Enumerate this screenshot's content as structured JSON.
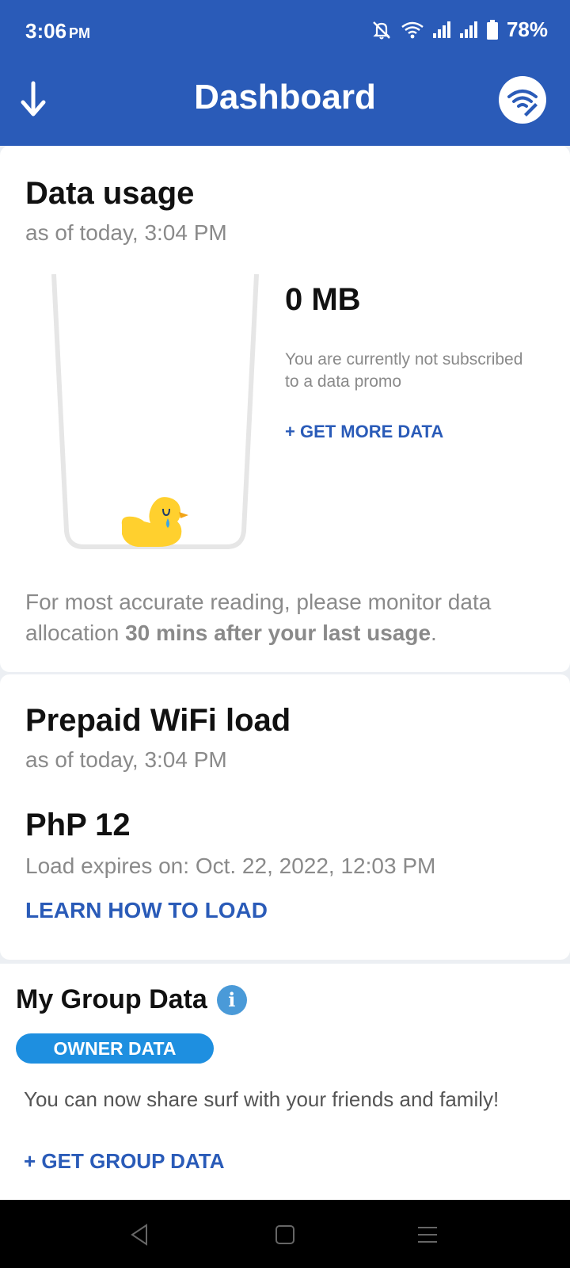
{
  "status_bar": {
    "time": "3:06",
    "ampm": "PM",
    "battery": "78%",
    "icons": [
      "mute-icon",
      "wifi-icon",
      "signal-icon",
      "signal-icon",
      "battery-icon"
    ]
  },
  "app_bar": {
    "title": "Dashboard",
    "left_icon": "download-arrow-icon",
    "right_icon": "wifi-tool-icon"
  },
  "data_usage": {
    "title": "Data usage",
    "as_of": "as of today, 3:04 PM",
    "value": "0 MB",
    "note": "You are currently not subscribed to a data promo",
    "get_more": "+ GET MORE DATA",
    "accuracy_prefix": "For most accurate reading, please monitor data allocation ",
    "accuracy_bold": "30 mins after your last usage",
    "accuracy_suffix": "."
  },
  "prepaid": {
    "title": "Prepaid WiFi load",
    "as_of": "as of today, 3:04 PM",
    "amount": "PhP 12",
    "expiry": "Load expires on: Oct. 22, 2022, 12:03 PM",
    "learn": "LEARN HOW TO LOAD"
  },
  "group": {
    "title": "My Group Data",
    "info_icon": "i",
    "pill": "OWNER DATA",
    "share_text": "You can now share surf with your friends and family!",
    "get_group": "+ GET GROUP DATA"
  },
  "colors": {
    "brand_blue": "#2a5bb8",
    "pill_blue": "#1e8fe0",
    "info_blue": "#4a9ad8",
    "duck_yellow": "#ffd02e"
  }
}
